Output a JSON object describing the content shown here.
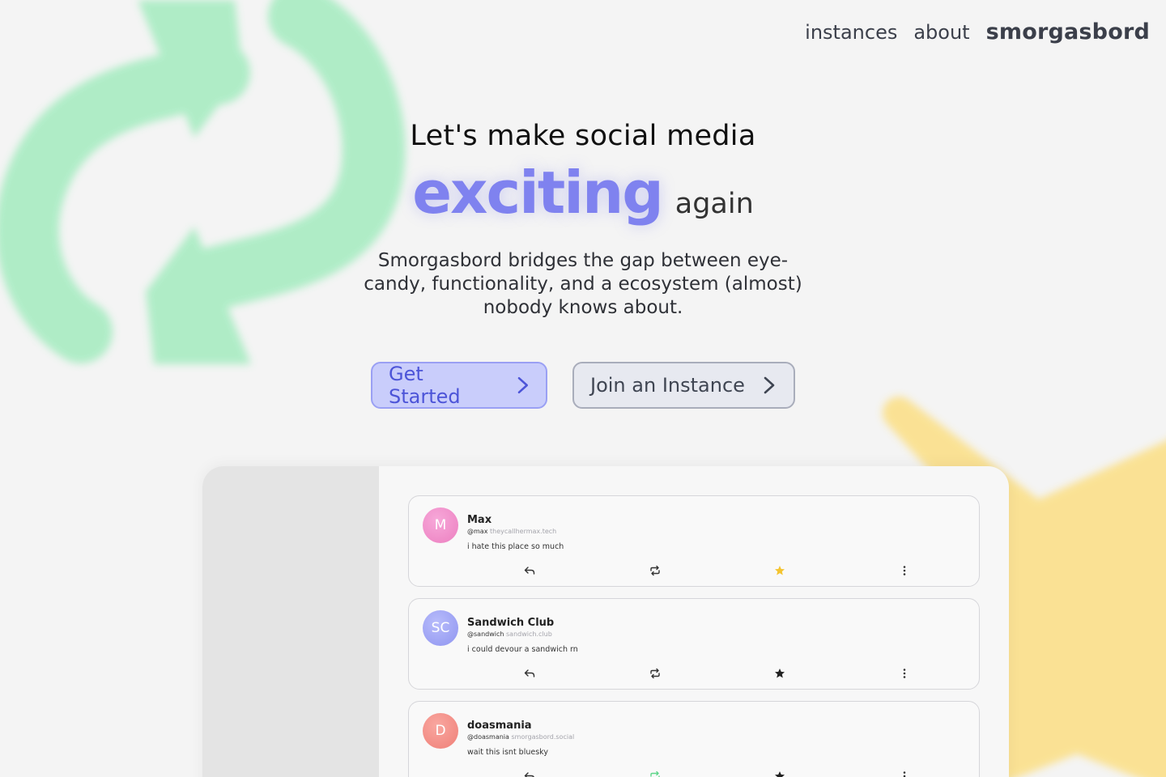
{
  "nav": {
    "links": [
      "instances",
      "about"
    ],
    "brand": "smorgasbord"
  },
  "hero": {
    "headline": "Let's make social media",
    "highlight": "exciting",
    "highlight_suffix": "again",
    "subtitle": "Smorgasbord bridges the gap between eye-candy, functionality, and a ecosystem (almost) nobody knows about."
  },
  "cta": {
    "primary": "Get Started",
    "secondary": "Join an Instance"
  },
  "preview": {
    "posts": [
      {
        "initials": "M",
        "name": "Max",
        "handle": "@max",
        "domain": "theycallhermax.tech",
        "body": "i hate this place so much",
        "favorited": true,
        "reposted": false
      },
      {
        "initials": "SC",
        "name": "Sandwich Club",
        "handle": "@sandwich",
        "domain": "sandwich.club",
        "body": "i could devour a sandwich rn",
        "favorited": false,
        "reposted": false
      },
      {
        "initials": "D",
        "name": "doasmania",
        "handle": "@doasmania",
        "domain": "smorgasbord.social",
        "body": "wait this isnt bluesky",
        "favorited": false,
        "reposted": true
      }
    ]
  },
  "colors": {
    "accent": "#7f82ef",
    "favorite": "#f4c430",
    "repost_active": "#5ed68a",
    "bg_arrows": "#a8ecc2",
    "bg_star": "#fbe08a"
  }
}
